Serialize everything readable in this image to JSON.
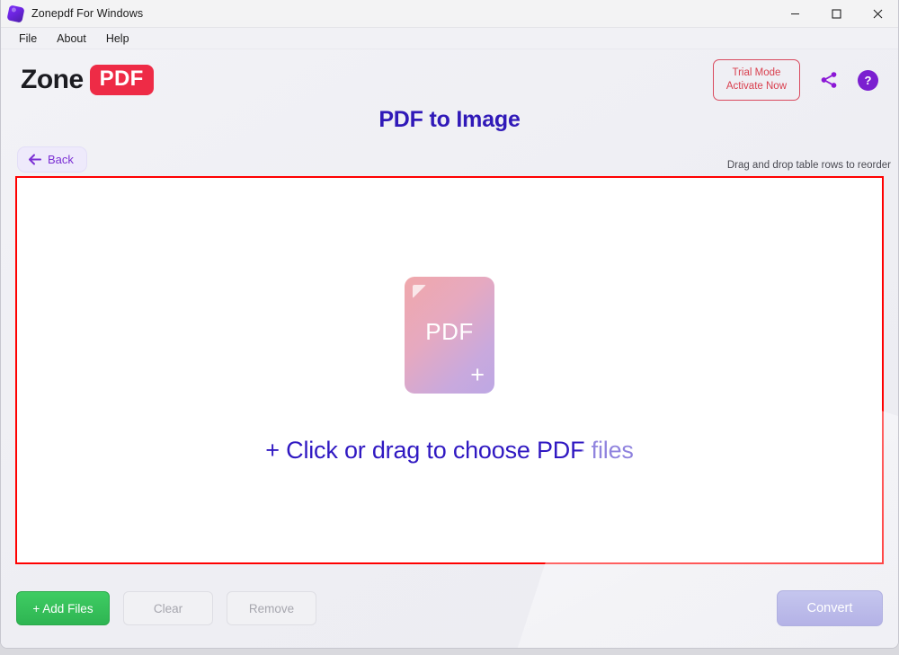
{
  "window": {
    "title": "Zonepdf For Windows",
    "app_icon": "app-logo-icon",
    "controls": {
      "minimize": "minimize-icon",
      "maximize": "maximize-icon",
      "close": "close-icon"
    }
  },
  "menubar": {
    "items": [
      {
        "label": "File"
      },
      {
        "label": "About"
      },
      {
        "label": "Help"
      }
    ]
  },
  "header": {
    "logo": {
      "word": "Zone",
      "badge": "PDF",
      "badge_color": "#ee2b46"
    },
    "trial_button": {
      "label": "Trial Mode\nActivate Now",
      "color": "#d9404f"
    },
    "share_icon": "share-icon",
    "help_icon": "help-icon",
    "help_glyph": "?"
  },
  "page": {
    "title": "PDF to Image",
    "title_color": "#3019b8",
    "back_label": "Back",
    "hint": "Drag and drop table rows to reorder"
  },
  "dropzone": {
    "border_color": "#ff0000",
    "card_label": "PDF",
    "card_plus": "+",
    "prompt": "+ Click or drag to choose PDF files",
    "prompt_color": "#3019c2"
  },
  "footer": {
    "add_files": "+ Add Files",
    "clear": "Clear",
    "remove": "Remove",
    "convert": "Convert",
    "add_color": "#2eb552",
    "convert_color": "#b4b2e6"
  }
}
